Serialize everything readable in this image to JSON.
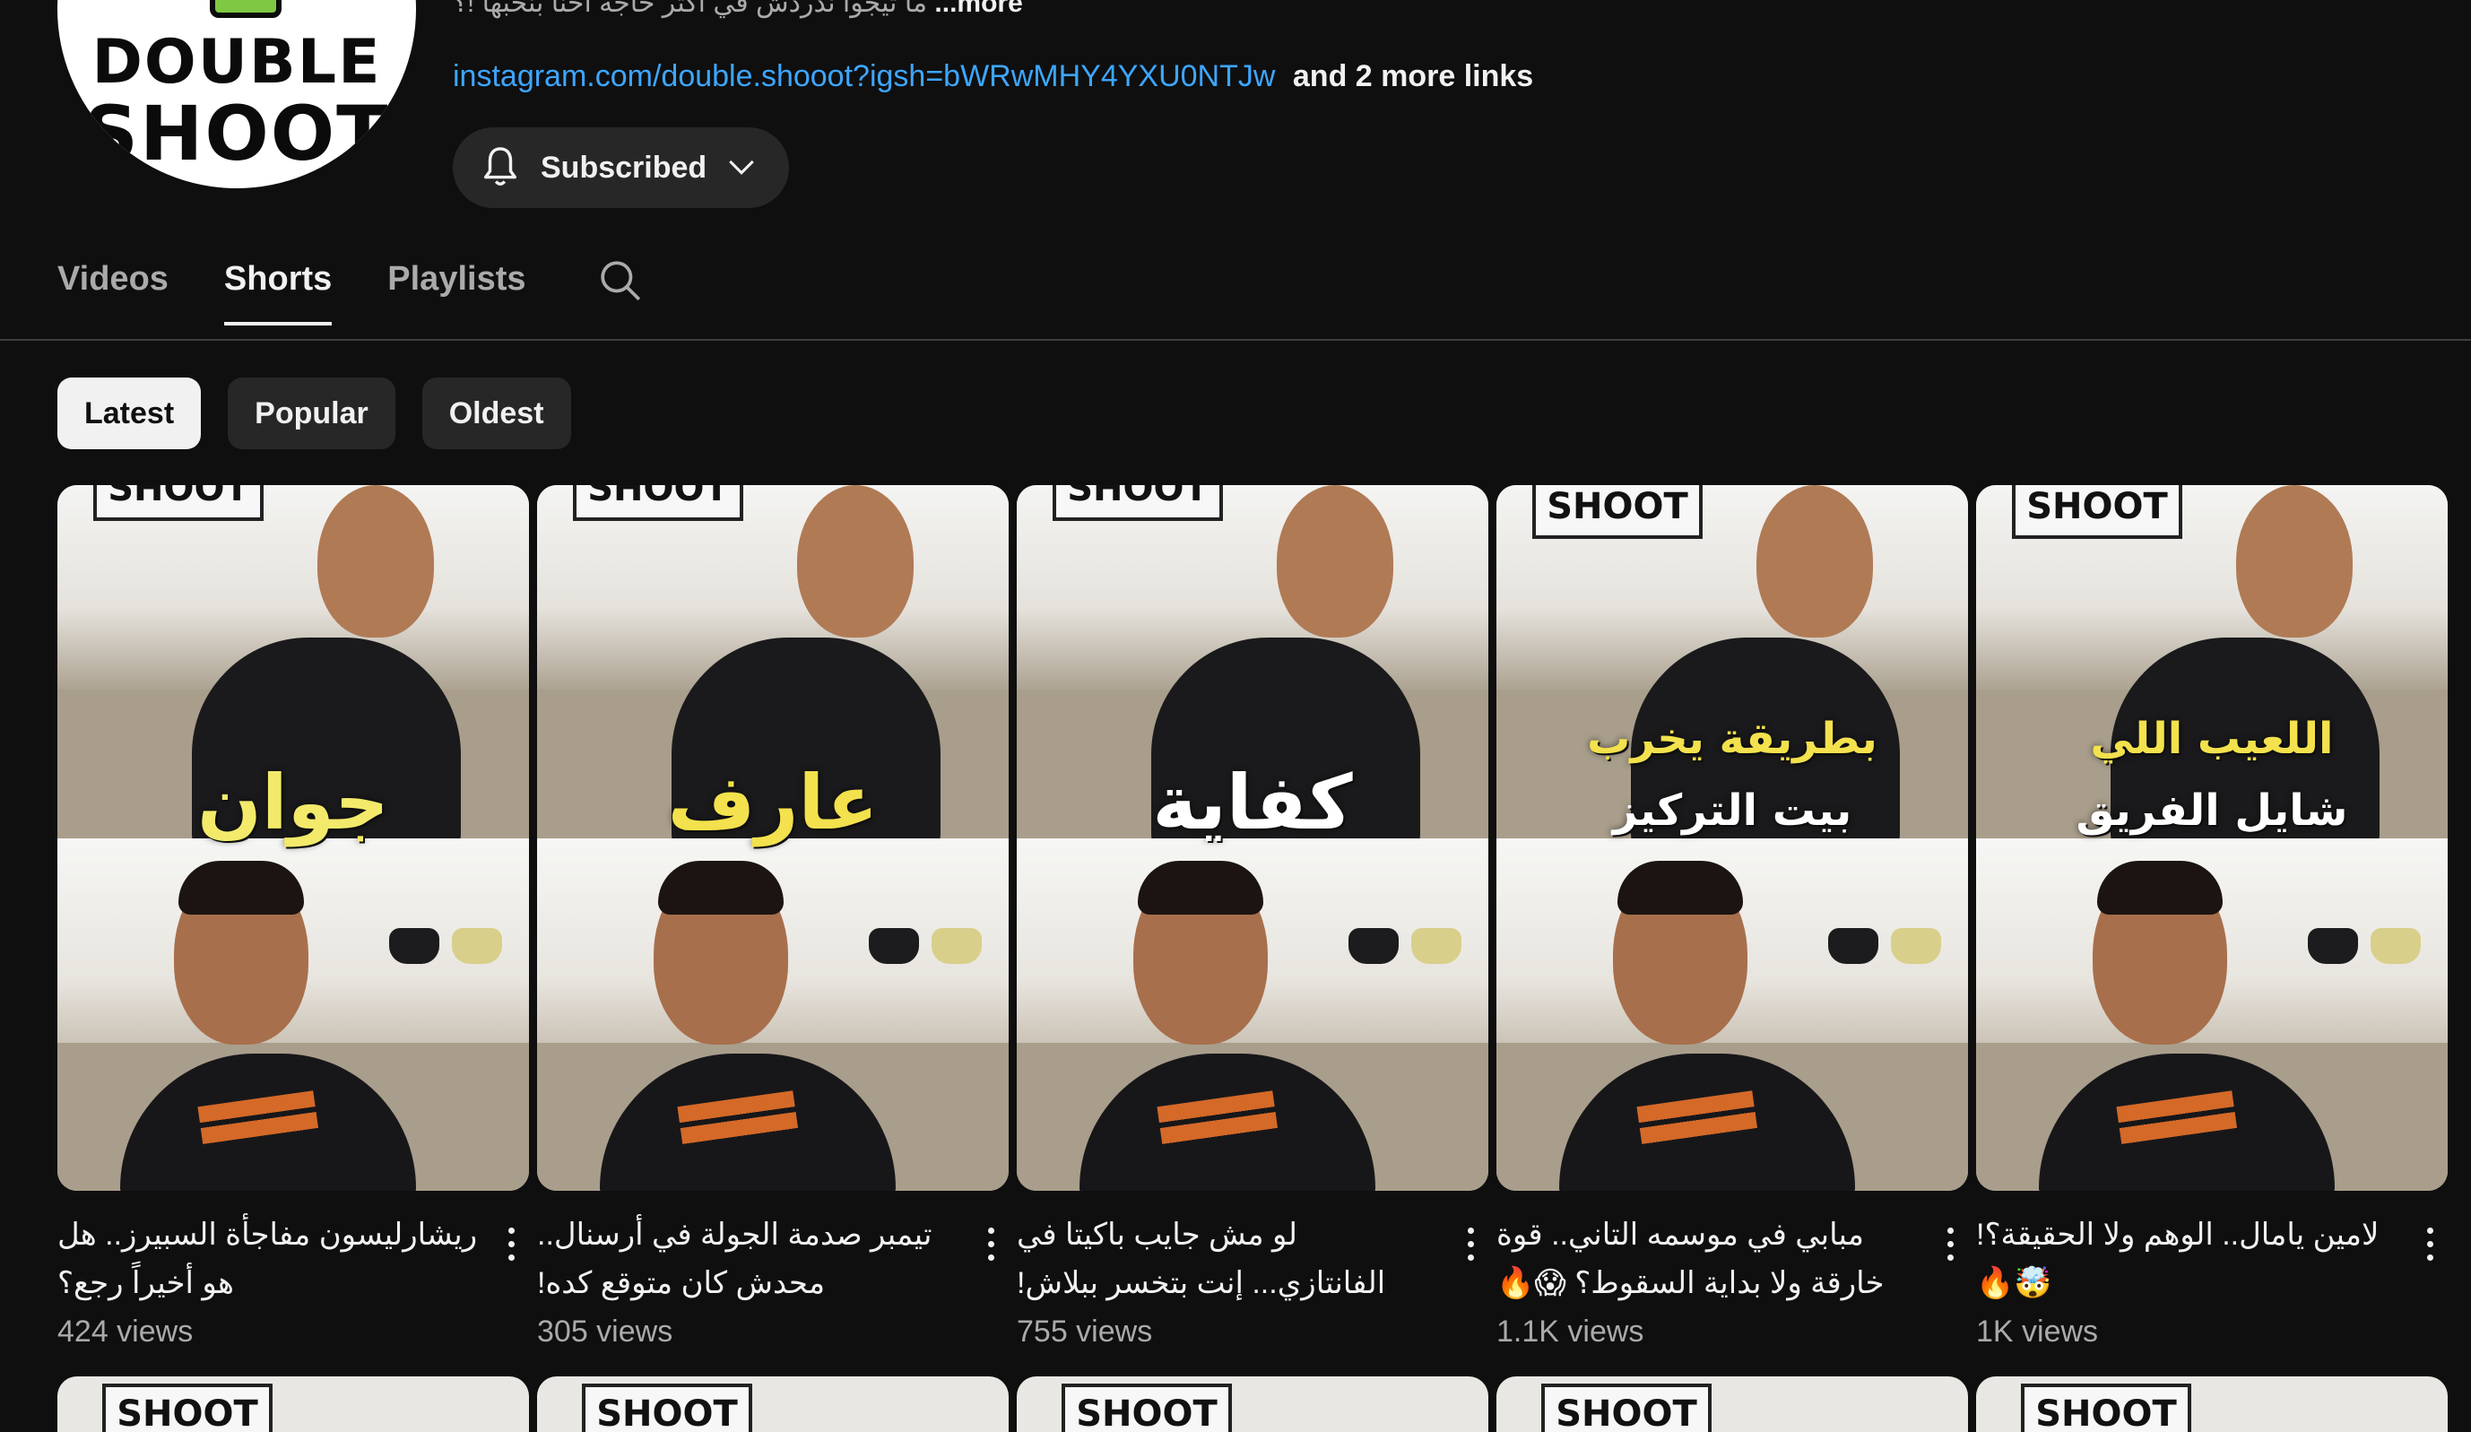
{
  "channel": {
    "avatar_line1": "DOUBLE",
    "avatar_line2": "SHOOT",
    "description": "ما تيجوا ندردش في أكتر حاجة احنا بنحبها !؟",
    "description_more": "...more",
    "link": "instagram.com/double.shooot?igsh=bWRwMHY4YXU0NTJw",
    "more_links": "and 2 more links",
    "subscribe_label": "Subscribed"
  },
  "tabs": [
    {
      "label": "Videos",
      "active": false
    },
    {
      "label": "Shorts",
      "active": true
    },
    {
      "label": "Playlists",
      "active": false
    }
  ],
  "chips": [
    {
      "label": "Latest",
      "active": true
    },
    {
      "label": "Popular",
      "active": false
    },
    {
      "label": "Oldest",
      "active": false
    }
  ],
  "shorts": [
    {
      "overlay": "جوان",
      "overlay_color": "#f3ea6b",
      "title": "ريشارليسون مفاجأة السبيرز.. هل هو أخيراً رجع؟",
      "views": "424 views"
    },
    {
      "overlay": "عارف",
      "overlay_color": "#f3e14d",
      "title": "تيمبر صدمة الجولة في أرسنال.. محدش كان متوقع كده!",
      "views": "305 views"
    },
    {
      "overlay": "كفاية",
      "overlay_color": "#ffffff",
      "title": "لو مش جايب باكيتا في الفانتازي... إنت بتخسر ببلاش!",
      "views": "755 views"
    },
    {
      "overlay_line1": "بطريقة يخرب",
      "overlay_line2": "بيت التركيز",
      "overlay_color": "#f3e14d",
      "title": "مبابي في موسمه التاني.. قوة خارقة ولا بداية السقوط؟ 😱🔥",
      "views": "1.1K views"
    },
    {
      "overlay_line1": "اللعيب اللي",
      "overlay_line2": "شايل الفريق",
      "overlay_color": "#f3e14d",
      "title": "لامين يامال.. الوهم ولا الحقيقة؟! 🤯🔥",
      "views": "1K views"
    }
  ],
  "thumb_logo": "SHOOT",
  "icons": {
    "bell": "bell-icon",
    "chevron": "chevron-down-icon",
    "search": "search-icon",
    "menu": "more-vert-icon"
  }
}
